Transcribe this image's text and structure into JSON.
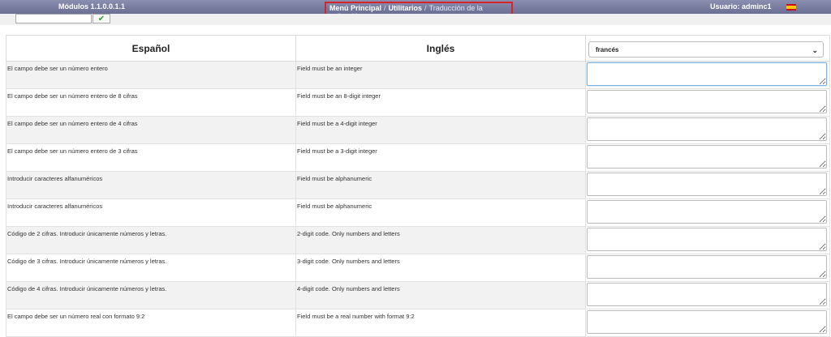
{
  "header": {
    "module": "Módulos 1.1.0.0.1.1",
    "breadcrumb": [
      "Menú Principal",
      "Utilitarios",
      "Traducción de la aplicación"
    ],
    "separator": "/",
    "user": "Usuario: adminc1"
  },
  "search": {
    "value": "",
    "ok_symbol": "✔"
  },
  "table": {
    "columns": [
      "Español",
      "Inglés"
    ],
    "language_select": "francés",
    "rows": [
      {
        "es": "El campo debe ser un número entero",
        "en": "Field must be an integer"
      },
      {
        "es": "El campo debe ser un número entero de 8 cifras",
        "en": "Field must be an 8-digit integer"
      },
      {
        "es": "El campo debe ser un número entero de 4 cifras",
        "en": "Field must be a 4-digit integer"
      },
      {
        "es": "El campo debe ser un número entero de 3 cifras",
        "en": "Field must be a 3-digit integer"
      },
      {
        "es": "Introducir caracteres alfanuméricos",
        "en": "Field must be alphanumeric"
      },
      {
        "es": "Introducir caracteres alfanuméricos",
        "en": "Field must be alphanumeric"
      },
      {
        "es": "Código de 2 cifras. Introducir únicamente números y letras.",
        "en": "2-digit code. Only numbers and letters"
      },
      {
        "es": "Código de 3 cifras. Introducir únicamente números y letras.",
        "en": "3-digit code. Only numbers and letters"
      },
      {
        "es": "Código de 4 cifras. Introducir únicamente números y letras.",
        "en": "4-digit code. Only numbers and letters"
      },
      {
        "es": "El campo debe ser un número real con formato 9:2",
        "en": "Field must be a real number with format 9:2"
      }
    ]
  }
}
